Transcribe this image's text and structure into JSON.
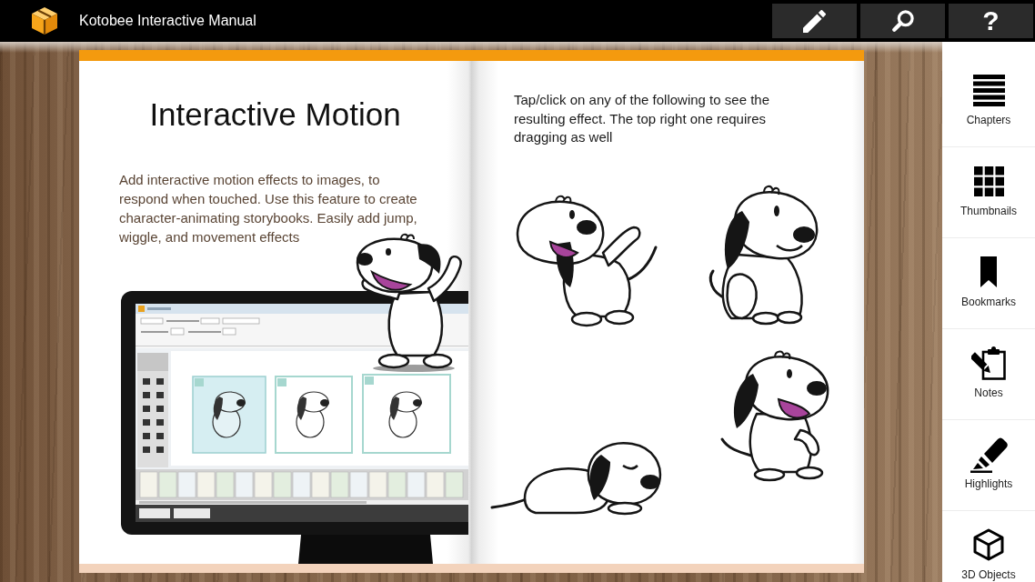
{
  "app_bar": {
    "title": "Kotobee Interactive Manual",
    "actions": [
      {
        "kind": "edit"
      },
      {
        "kind": "search"
      },
      {
        "kind": "help",
        "glyph": "?"
      }
    ]
  },
  "book": {
    "left_page": {
      "title": "Interactive Motion",
      "body": "Add interactive motion effects to images, to respond when touched. Use this feature to create character-animating storybooks. Easily add jump, wiggle, and movement effects"
    },
    "right_page": {
      "body": "Tap/click on any of the following to see the resulting effect. The top right one requires dragging as well"
    }
  },
  "sidebar": {
    "items": [
      {
        "kind": "chapters",
        "label": "Chapters"
      },
      {
        "kind": "thumbnails",
        "label": "Thumbnails"
      },
      {
        "kind": "bookmarks",
        "label": "Bookmarks"
      },
      {
        "kind": "notes",
        "label": "Notes"
      },
      {
        "kind": "highlights",
        "label": "Highlights"
      },
      {
        "kind": "objects3d",
        "label": "3D Objects"
      }
    ]
  }
}
